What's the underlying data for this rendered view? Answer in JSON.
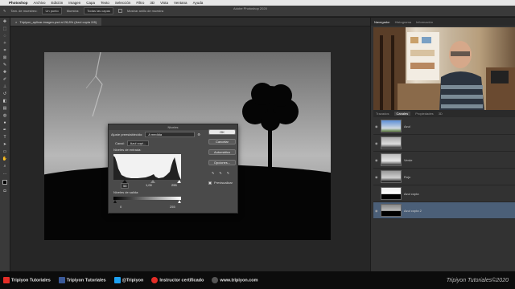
{
  "menubar": {
    "app_name": "Photoshop",
    "items": [
      "Archivo",
      "Edición",
      "Imagen",
      "Capa",
      "Texto",
      "Selección",
      "Filtro",
      "3D",
      "Vista",
      "Ventana",
      "Ayuda"
    ],
    "window_title": "Adobe Photoshop 2020"
  },
  "options": {
    "sample_label": "Tam. de muestreo:",
    "sample_value": "Un punto",
    "all_layers": "Muestra:",
    "all_layers_value": "Todas las capas",
    "ring": "Mostrar anillo de muestra"
  },
  "document": {
    "tab_title": "Tripiyon_aplicar-imagen.psd al 28,8% (Azul copia 2/8)"
  },
  "levels": {
    "title": "Niveles",
    "preset_label": "Ajuste preestablecido:",
    "preset_value": "A medida",
    "channel_label": "Canal:",
    "channel_value": "Azul copi...",
    "input_label": "Niveles de entrada:",
    "input_black": "58",
    "input_gray": "1,00",
    "input_white": "255",
    "output_label": "Niveles de salida:",
    "output_black": "0",
    "output_white": "255",
    "ok": "OK",
    "cancel": "Cancelar",
    "auto": "Automático",
    "options": "Opciones...",
    "preview": "Previsualizar"
  },
  "right": {
    "top_tabs": [
      "Navegador",
      "Histograma",
      "Información"
    ],
    "layer_tabs": [
      "Trazados",
      "Canales",
      "Propiedades",
      "3D"
    ],
    "layers": [
      {
        "name": "Azul",
        "active": false
      },
      {
        "name": "",
        "active": false
      },
      {
        "name": "Verde",
        "active": false
      },
      {
        "name": "Rojo",
        "active": false
      },
      {
        "name": "Azul copia",
        "active": false
      },
      {
        "name": "Azul copia 2",
        "active": true
      }
    ]
  },
  "status": {
    "items": [
      "Tripiyon Tutoriales",
      "Tripiyon Tutoriales",
      "@Tripiyon",
      "Instructor certificado",
      "www.tripiyon.com"
    ],
    "signature": "Tripiyon Tutoriales©2020"
  },
  "colors": {
    "accent": "#4b5f78",
    "youtube_red": "#e52d27",
    "facebook_blue": "#3b5998",
    "twitter_blue": "#1da1f2"
  }
}
